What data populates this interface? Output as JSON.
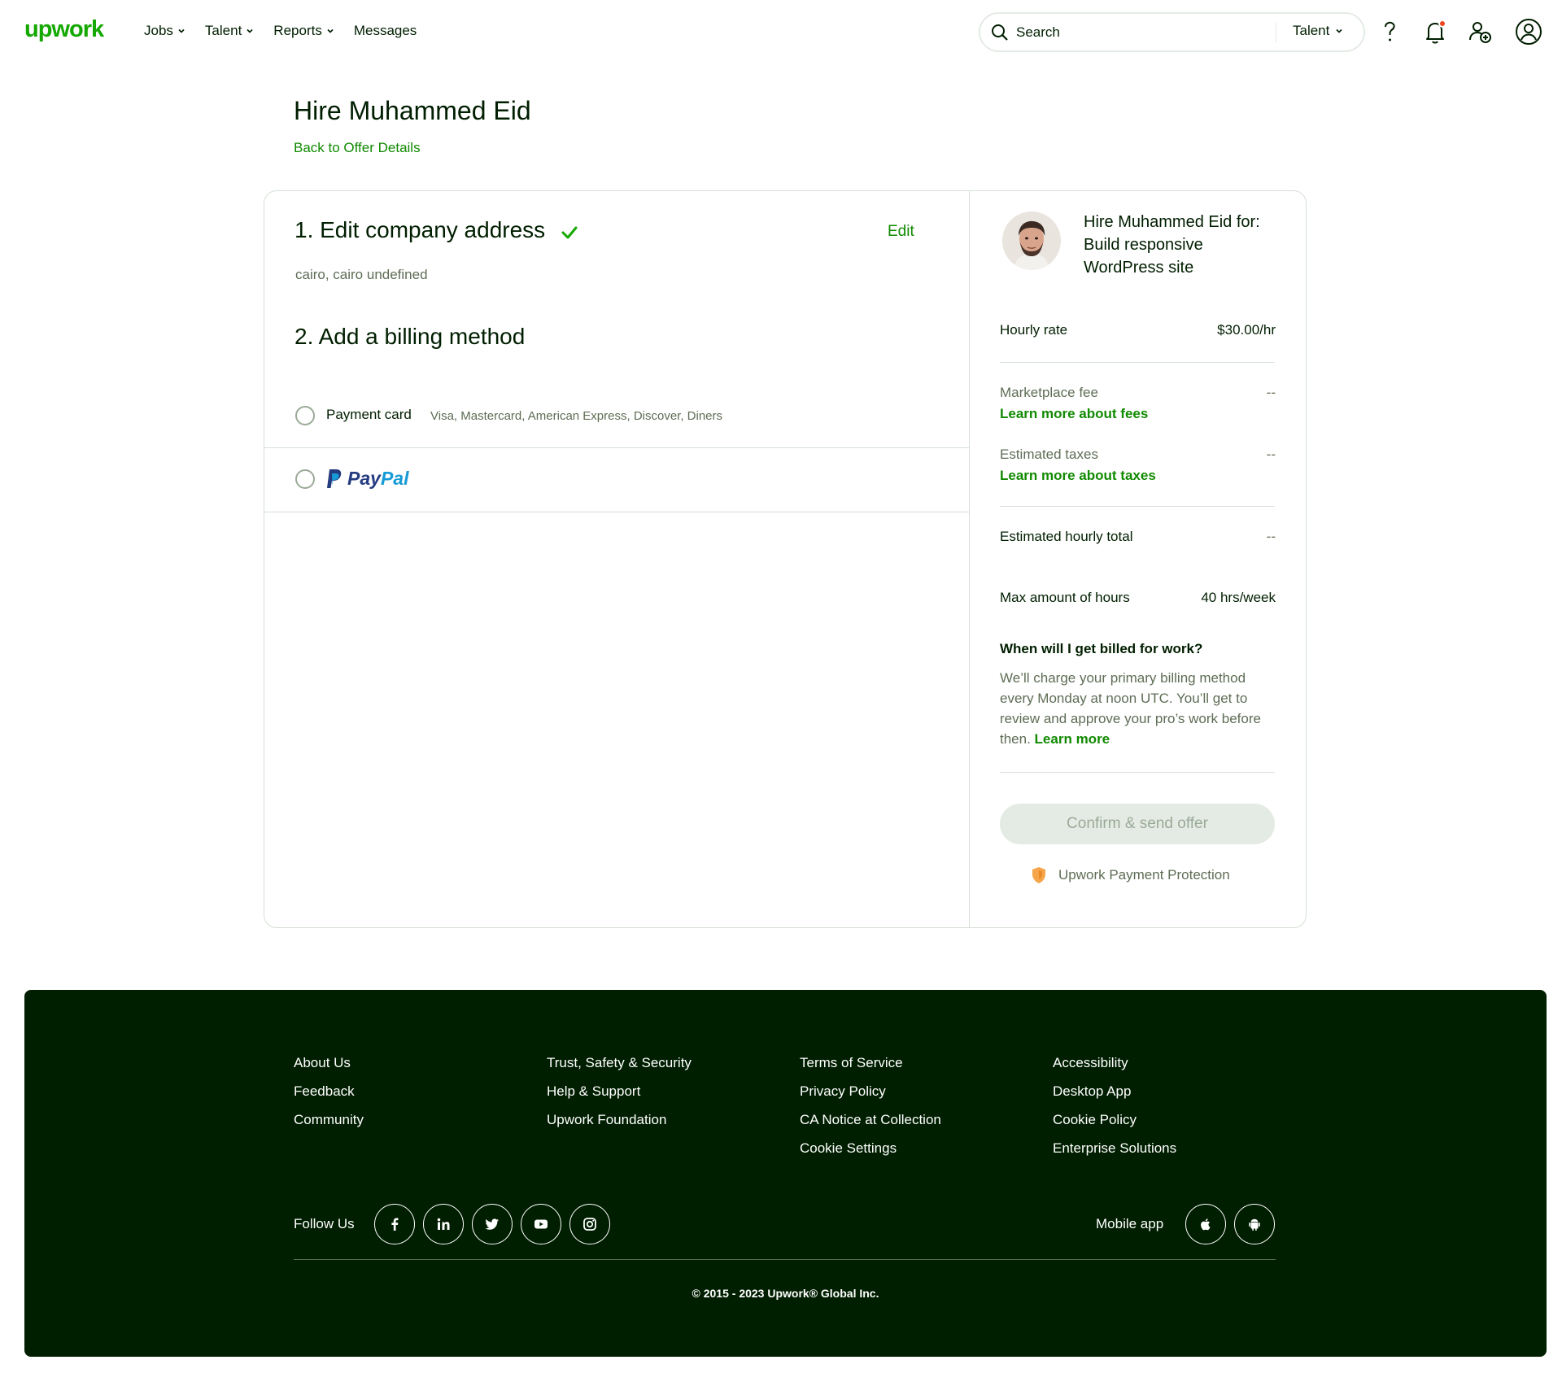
{
  "header": {
    "logo": "upwork",
    "nav": [
      "Jobs",
      "Talent",
      "Reports",
      "Messages"
    ],
    "search": {
      "placeholder": "Search",
      "scope": "Talent"
    }
  },
  "page": {
    "title": "Hire Muhammed Eid",
    "back_link": "Back to Offer Details"
  },
  "steps": {
    "step1_title": "1. Edit company address",
    "edit_label": "Edit",
    "address": "cairo, cairo undefined",
    "step2_title": "2. Add a billing method",
    "payment_card_label": "Payment card",
    "payment_card_types": "Visa, Mastercard, American Express, Discover, Diners",
    "paypal_pay": "Pay",
    "paypal_pal": "Pal"
  },
  "summary": {
    "hire_for": "Hire Muhammed Eid for: Build responsive WordPress site",
    "hourly_rate_label": "Hourly rate",
    "hourly_rate_value": "$30.00/hr",
    "marketplace_fee_label": "Marketplace fee",
    "marketplace_fee_value": "--",
    "fees_link": "Learn more about fees",
    "taxes_label": "Estimated taxes",
    "taxes_value": "--",
    "taxes_link": "Learn more about taxes",
    "hourly_total_label": "Estimated hourly total",
    "hourly_total_value": "--",
    "max_hours_label": "Max amount of hours",
    "max_hours_value": "40 hrs/week",
    "billed_question": "When will I get billed for work?",
    "billed_answer": "We’ll charge your primary billing method every Monday at noon UTC. You’ll get to review and approve your pro’s work before then.",
    "billed_learn_more": "Learn more",
    "confirm_button": "Confirm & send offer",
    "protection": "Upwork Payment Protection"
  },
  "footer": {
    "col1": [
      "About Us",
      "Feedback",
      "Community"
    ],
    "col2": [
      "Trust, Safety & Security",
      "Help & Support",
      "Upwork Foundation"
    ],
    "col3": [
      "Terms of Service",
      "Privacy Policy",
      "CA Notice at Collection",
      "Cookie Settings"
    ],
    "col4": [
      "Accessibility",
      "Desktop App",
      "Cookie Policy",
      "Enterprise Solutions"
    ],
    "follow_us": "Follow Us",
    "social": [
      "facebook-icon",
      "linkedin-icon",
      "twitter-icon",
      "youtube-icon",
      "instagram-icon"
    ],
    "mobile_app": "Mobile app",
    "mobile": [
      "apple-icon",
      "android-icon"
    ],
    "copyright": "© 2015 - 2023 Upwork® Global Inc."
  },
  "colors": {
    "brand_green": "#14a800",
    "link_green": "#108a00",
    "footer_bg": "#001e00",
    "notification": "#f0441f"
  }
}
